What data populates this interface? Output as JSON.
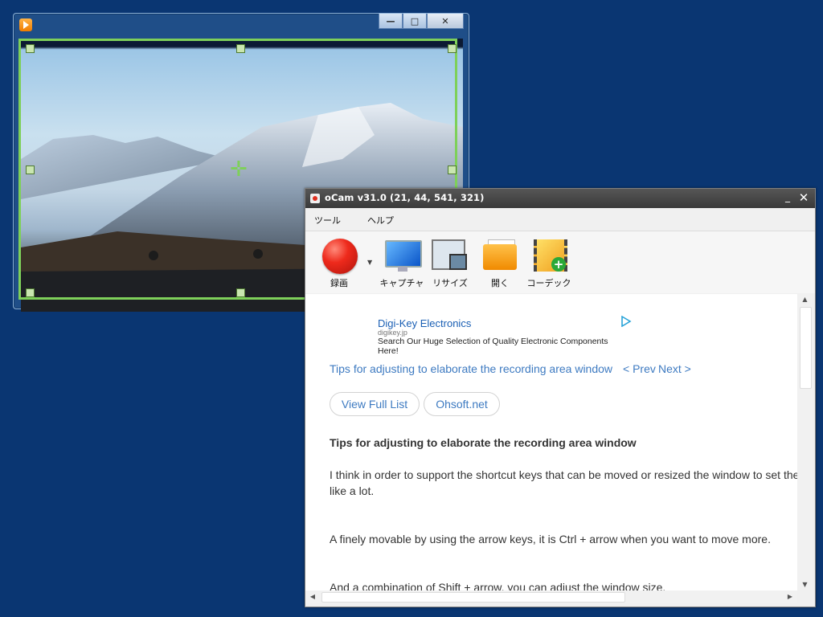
{
  "video_window": {
    "title_buttons": {
      "minimize": "—",
      "maximize": "□",
      "close": "✕"
    },
    "selection_color": "#7ed05a"
  },
  "ocam": {
    "title": "oCam v31.0 (21, 44, 541, 321)",
    "title_buttons": {
      "minimize": "_",
      "close": "✕"
    },
    "menu": [
      "ツール",
      "ヘルプ"
    ],
    "toolbar": [
      {
        "label": "録画",
        "icon": "record-icon"
      },
      {
        "label": "キャプチャ",
        "icon": "capture-icon"
      },
      {
        "label": "リサイズ",
        "icon": "resize-icon"
      },
      {
        "label": "開く",
        "icon": "open-folder-icon"
      },
      {
        "label": "コーデック",
        "icon": "codec-icon"
      }
    ],
    "dropdown_glyph": "▼"
  },
  "content": {
    "ad": {
      "title": "Digi-Key Electronics",
      "domain": "digikey.jp",
      "description": "Search Our Huge Selection of Quality Electronic Components Here!"
    },
    "article_link": "Tips for adjusting to elaborate the recording area window",
    "prev_link": "< Prev",
    "next_link": "Next >",
    "buttons": [
      "View Full List",
      "Ohsoft.net"
    ],
    "heading": "Tips for adjusting to elaborate the recording area window",
    "paragraphs": [
      "I think in order to support the shortcut keys that can be moved or resized the window to set the",
      "like a lot.",
      "A finely movable by using the arrow keys, it is Ctrl + arrow when you want to move more.",
      "And a combination of Shift + arrow, you can adjust the window size."
    ]
  },
  "scrollbar": {
    "up": "▲",
    "down": "▼",
    "left": "◀",
    "right": "▶"
  }
}
